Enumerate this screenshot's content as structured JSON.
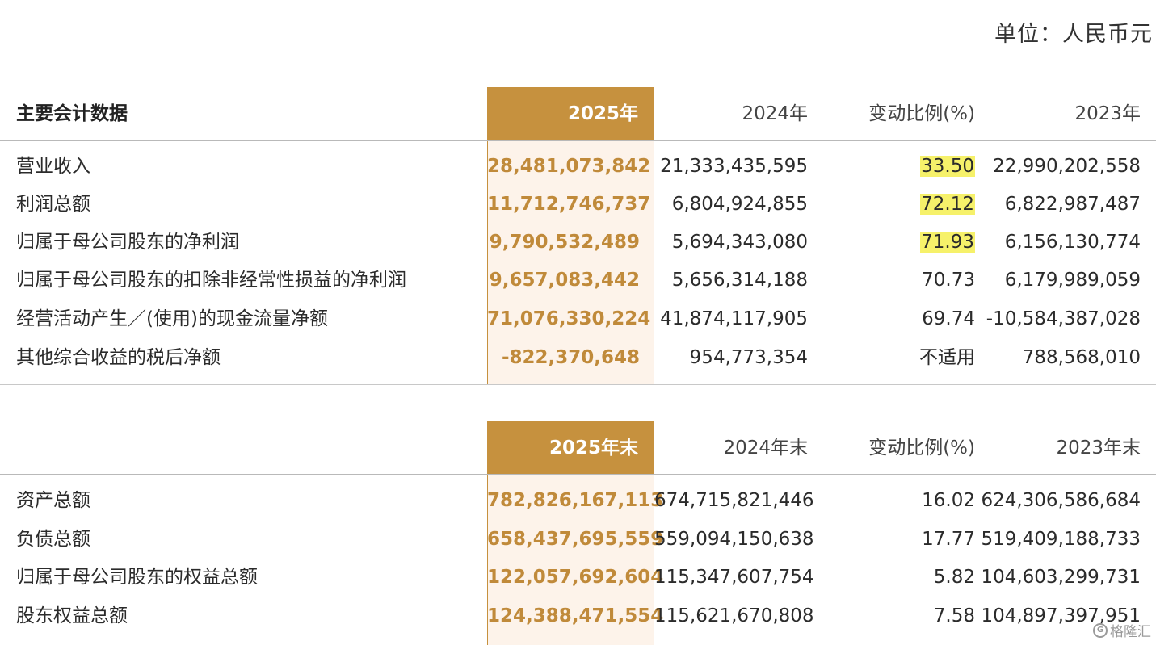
{
  "unit_note": "单位：人民币元",
  "table1": {
    "header": {
      "label": "主要会计数据",
      "cur": "2025年",
      "prev": "2024年",
      "chg": "变动比例(%)",
      "old": "2023年"
    },
    "rows": [
      {
        "label": "营业收入",
        "cur": "28,481,073,842",
        "prev": "21,333,435,595",
        "chg": "33.50",
        "old": "22,990,202,558",
        "chg_highlight": true
      },
      {
        "label": "利润总额",
        "cur": "11,712,746,737",
        "prev": "6,804,924,855",
        "chg": "72.12",
        "old": "6,822,987,487",
        "chg_highlight": true
      },
      {
        "label": "归属于母公司股东的净利润",
        "cur": "9,790,532,489",
        "prev": "5,694,343,080",
        "chg": "71.93",
        "old": "6,156,130,774",
        "chg_highlight": true
      },
      {
        "label": "归属于母公司股东的扣除非经常性损益的净利润",
        "cur": "9,657,083,442",
        "prev": "5,656,314,188",
        "chg": "70.73",
        "old": "6,179,989,059",
        "chg_highlight": false
      },
      {
        "label": "经营活动产生／(使用)的现金流量净额",
        "cur": "71,076,330,224",
        "prev": "41,874,117,905",
        "chg": "69.74",
        "old": "-10,584,387,028",
        "chg_highlight": false
      },
      {
        "label": "其他综合收益的税后净额",
        "cur": "-822,370,648",
        "prev": "954,773,354",
        "chg": "不适用",
        "old": "788,568,010",
        "chg_highlight": false
      }
    ]
  },
  "table2": {
    "header": {
      "label": "",
      "cur": "2025年末",
      "prev": "2024年末",
      "chg": "变动比例(%)",
      "old": "2023年末"
    },
    "rows": [
      {
        "label": "资产总额",
        "cur": "782,826,167,113",
        "prev": "674,715,821,446",
        "chg": "16.02",
        "old": "624,306,586,684"
      },
      {
        "label": "负债总额",
        "cur": "658,437,695,559",
        "prev": "559,094,150,638",
        "chg": "17.77",
        "old": "519,409,188,733"
      },
      {
        "label": "归属于母公司股东的权益总额",
        "cur": "122,057,692,604",
        "prev": "115,347,607,754",
        "chg": "5.82",
        "old": "104,603,299,731"
      },
      {
        "label": "股东权益总额",
        "cur": "124,388,471,554",
        "prev": "115,621,670,808",
        "chg": "7.58",
        "old": "104,897,397,951"
      }
    ]
  },
  "watermark": {
    "logo": "G",
    "text": "格隆汇"
  },
  "colors": {
    "accent": "#c6913e",
    "accent_text": "#c08a3a",
    "column_tint": "#fdf3ea",
    "highlight": "#f6f16a"
  }
}
